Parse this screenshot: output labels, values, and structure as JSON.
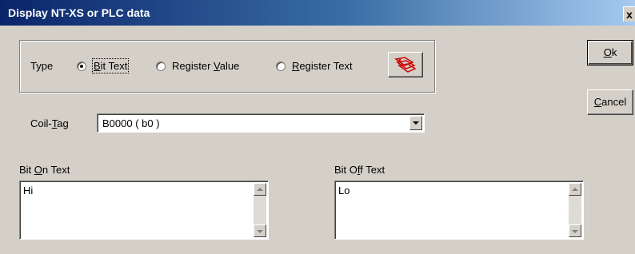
{
  "window": {
    "title": "Display NT-XS or PLC data",
    "close_glyph": "x"
  },
  "type_group": {
    "label": "Type",
    "options": [
      {
        "label": "Bit Text",
        "selected": true
      },
      {
        "label": "Register Value",
        "selected": false
      },
      {
        "label": "Register Text",
        "selected": false
      }
    ],
    "icon_button": "tags-icon"
  },
  "buttons": {
    "ok": "Ok",
    "cancel": "Cancel"
  },
  "coil_tag": {
    "label": "Coil-Tag",
    "value": "B0000 ( b0 )"
  },
  "bit_on": {
    "label": "Bit On Text",
    "value": "Hi"
  },
  "bit_off": {
    "label": "Bit Off Text",
    "value": "Lo"
  },
  "colors": {
    "title_start": "#0a246a",
    "title_end": "#a6caf0",
    "dialog_bg": "#d4d0c8",
    "icon_red": "#cc0000"
  }
}
